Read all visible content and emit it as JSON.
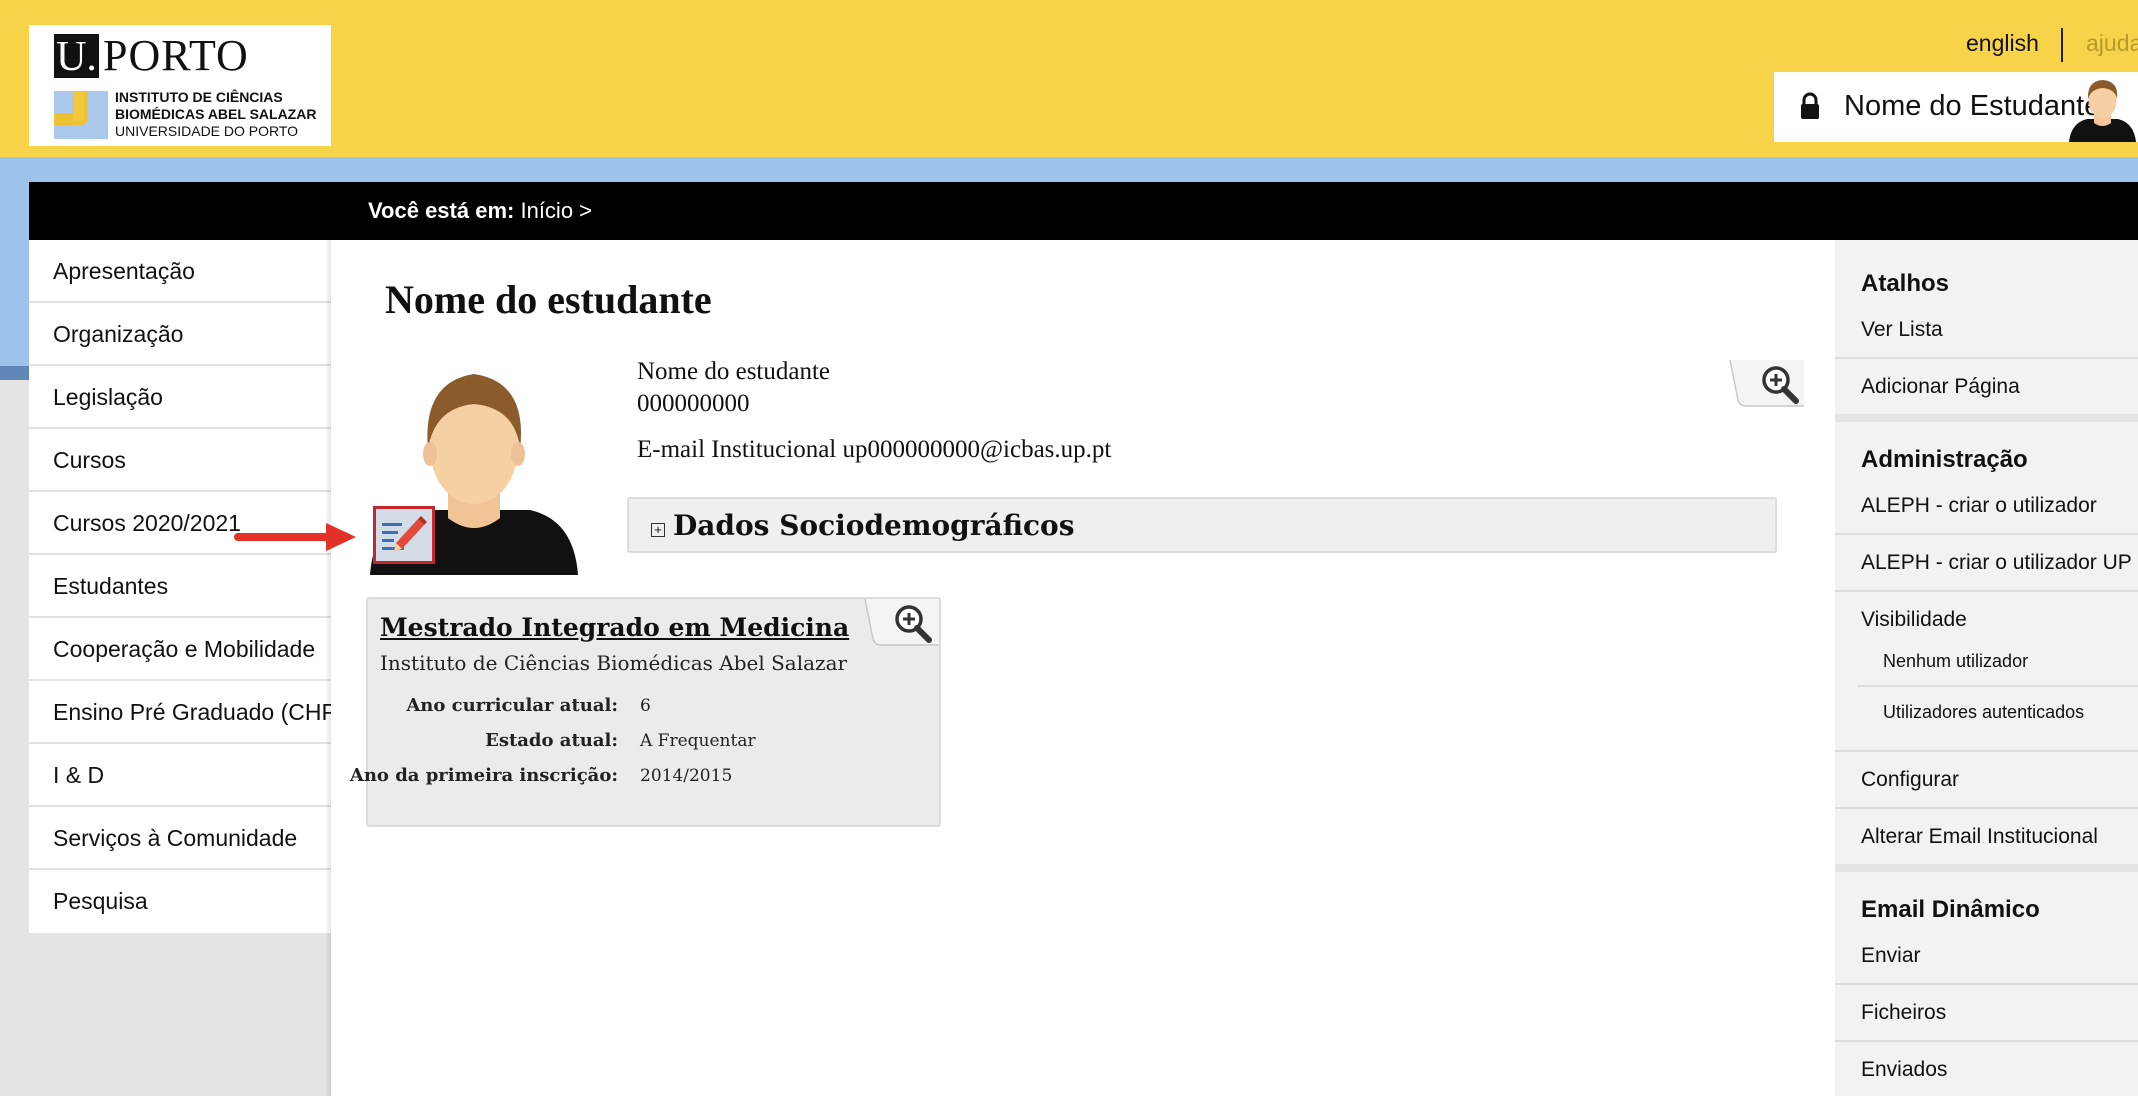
{
  "header": {
    "logo": {
      "u": "U.",
      "porto": "PORTO",
      "line1": "INSTITUTO DE CIÊNCIAS",
      "line2": "BIOMÉDICAS ABEL SALAZAR",
      "line3": "UNIVERSIDADE DO PORTO"
    },
    "lang_link": "english",
    "help_link": "ajuda",
    "user_name": "Nome do Estudante",
    "accent": "#f7d34a"
  },
  "breadcrumb": {
    "prefix": "Você está em:",
    "path": "Início >"
  },
  "left_nav": {
    "items": [
      "Apresentação",
      "Organização",
      "Legislação",
      "Cursos",
      "Cursos 2020/2021",
      "Estudantes",
      "Cooperação e Mobilidade",
      "Ensino Pré Graduado (CHP)",
      "I & D",
      "Serviços à Comunidade",
      "Pesquisa"
    ]
  },
  "main": {
    "title": "Nome do estudante",
    "student_name": "Nome do estudante",
    "student_number": "000000000",
    "email_line": "E-mail Institucional up000000000@icbas.up.pt",
    "socio_label": "Dados Sociodemográficos",
    "course": {
      "title": "Mestrado Integrado em Medicina",
      "institution": "Instituto de Ciências Biomédicas Abel Salazar",
      "rows": [
        {
          "label": "Ano curricular atual:",
          "value": "6"
        },
        {
          "label": "Estado atual:",
          "value": "A Frequentar"
        },
        {
          "label": "Ano da primeira inscrição:",
          "value": "2014/2015"
        }
      ]
    }
  },
  "right_nav": {
    "atalhos_head": "Atalhos",
    "ver_lista": "Ver Lista",
    "adicionar_pagina": "Adicionar Página",
    "admin_head": "Administração",
    "aleph1": "ALEPH - criar o utilizador",
    "aleph2": "ALEPH - criar o utilizador UP",
    "visibilidade": "Visibilidade",
    "nenhum": "Nenhum utilizador",
    "autenticados": "Utilizadores autenticados",
    "configurar": "Configurar",
    "alterar_email": "Alterar Email Institucional",
    "email_head": "Email Dinâmico",
    "enviar": "Enviar",
    "ficheiros": "Ficheiros",
    "enviados": "Enviados"
  }
}
